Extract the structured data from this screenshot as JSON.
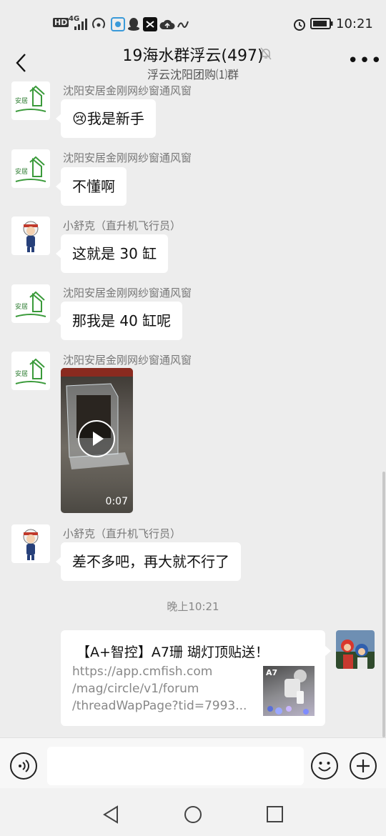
{
  "status_bar": {
    "left_badges": "HD",
    "net": "4G",
    "time": "10:21"
  },
  "header": {
    "title": "19海水群浮云(497)",
    "subtitle": "浮云沈阳团购⑴群"
  },
  "messages": [
    {
      "sender": "沈阳安居金刚网纱窗通风窗",
      "emoji": "😢",
      "text": "我是新手"
    },
    {
      "sender": "沈阳安居金刚网纱窗通风窗",
      "text": "不懂啊"
    },
    {
      "sender": "小舒克（直升机飞行员）",
      "text": "这就是 30 缸"
    },
    {
      "sender": "沈阳安居金刚网纱窗通风窗",
      "text": "那我是 40 缸呢"
    },
    {
      "sender": "沈阳安居金刚网纱窗通风窗",
      "video_duration": "0:07"
    },
    {
      "sender": "小舒克（直升机飞行员）",
      "text": "差不多吧，再大就不行了"
    }
  ],
  "timestamp": "晚上10:21",
  "link_card": {
    "title": "【A+智控】A7珊 瑚灯顶贴送！",
    "url_lines": [
      "https://app.cmfish.com",
      "/mag/circle/v1/forum",
      "/threadWapPage?tid=7993..."
    ],
    "thumb_label": "A7"
  },
  "avatar_logo_text": "安居",
  "colors": {
    "background": "#ededed",
    "bubble": "#ffffff",
    "logo_green": "#3a9a3a"
  }
}
